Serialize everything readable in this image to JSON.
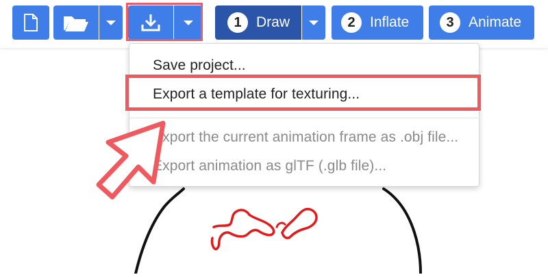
{
  "toolbar": {
    "steps": [
      {
        "number": "1",
        "label": "Draw"
      },
      {
        "number": "2",
        "label": "Inflate"
      },
      {
        "number": "3",
        "label": "Animate"
      }
    ],
    "icons": {
      "new": "new-document-icon",
      "open": "folder-icon",
      "save": "download-icon",
      "caret": "chevron-down-icon"
    }
  },
  "menu": {
    "items": [
      {
        "label": "Save project...",
        "enabled": true
      },
      {
        "label": "Export a template for texturing...",
        "enabled": true
      },
      {
        "label": "Export the current animation frame as .obj file...",
        "enabled": false
      },
      {
        "label": "Export animation as glTF (.glb file)...",
        "enabled": false
      }
    ]
  },
  "colors": {
    "button_blue": "#3f7ee8",
    "active_blue": "#2a55a8",
    "highlight_red": "#ee5a5f",
    "drawing_red": "#e01b1b",
    "drawing_black": "#111111"
  }
}
